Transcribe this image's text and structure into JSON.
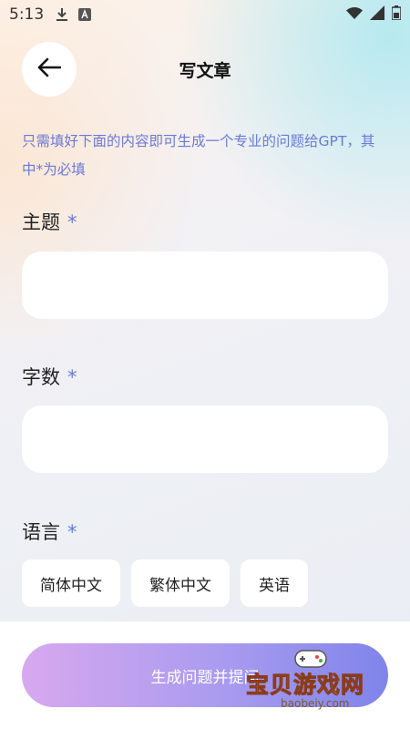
{
  "status_bar": {
    "time": "5:13",
    "icons": [
      "download-icon",
      "a-icon",
      "wifi-icon",
      "signal-icon",
      "battery-icon"
    ]
  },
  "header": {
    "title": "写文章",
    "back_icon": "arrow-left-icon"
  },
  "hint": "只需填好下面的内容即可生成一个专业的问题给GPT，其中*为必填",
  "form": {
    "topic": {
      "label": "主题",
      "required_mark": "*",
      "value": "",
      "placeholder": ""
    },
    "word_count": {
      "label": "字数",
      "required_mark": "*",
      "value": "",
      "placeholder": ""
    },
    "language": {
      "label": "语言",
      "required_mark": "*",
      "options": [
        "简体中文",
        "繁体中文",
        "英语"
      ]
    }
  },
  "submit_label": "生成问题并提问",
  "watermark": {
    "text": "宝贝游戏网",
    "url": "baobeiy.com"
  },
  "colors": {
    "accent": "#6a7ad6",
    "button_gradient_start": "#d8a8ef",
    "button_gradient_end": "#7f84ea"
  }
}
